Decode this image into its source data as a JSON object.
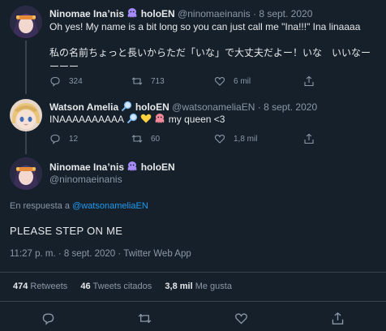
{
  "tweet1": {
    "name": "Ninomae Ina’nis",
    "name_suffix": "holoEN",
    "handle": "@ninomaeinanis",
    "dot": "·",
    "date": "8 sept. 2020",
    "line1": "Oh yes! My name is a bit long so you can just call me \"Ina!!!\" Ina linaaaa",
    "line2": "私の名前ちょっと長いからただ「いな」で大丈夫だよー！いな　いいなー",
    "line3": "ーーー",
    "replies": "324",
    "retweets": "713",
    "likes": "6 mil"
  },
  "tweet2": {
    "name": "Watson Amelia",
    "name_suffix": "holoEN",
    "handle": "@watsonameliaEN",
    "dot": "·",
    "date": "8 sept. 2020",
    "text_a": "INAAAAAAAAAA",
    "text_b": "my queen <3",
    "replies": "12",
    "retweets": "60",
    "likes": "1,8 mil"
  },
  "main": {
    "name": "Ninomae Ina’nis",
    "name_suffix": "holoEN",
    "handle": "@ninomaeinanis",
    "reply_prefix": "En respuesta a",
    "reply_to": "@watsonameliaEN",
    "text": "PLEASE STEP ON ME",
    "time": "11:27 p. m. · 8 sept. 2020 · Twitter Web App",
    "retweets_count": "474",
    "retweets_label": "Retweets",
    "quotes_count": "46",
    "quotes_label": "Tweets citados",
    "likes_count": "3,8 mil",
    "likes_label": "Me gusta"
  },
  "colors": {
    "background": "#15202b",
    "accent": "#1d9bf0",
    "muted": "#8b98a5",
    "octopus": "#a78bfa"
  },
  "icons": [
    "reply-icon",
    "retweet-icon",
    "like-icon",
    "share-icon",
    "octopus-icon",
    "magnifier-icon",
    "yellow-heart-icon"
  ]
}
